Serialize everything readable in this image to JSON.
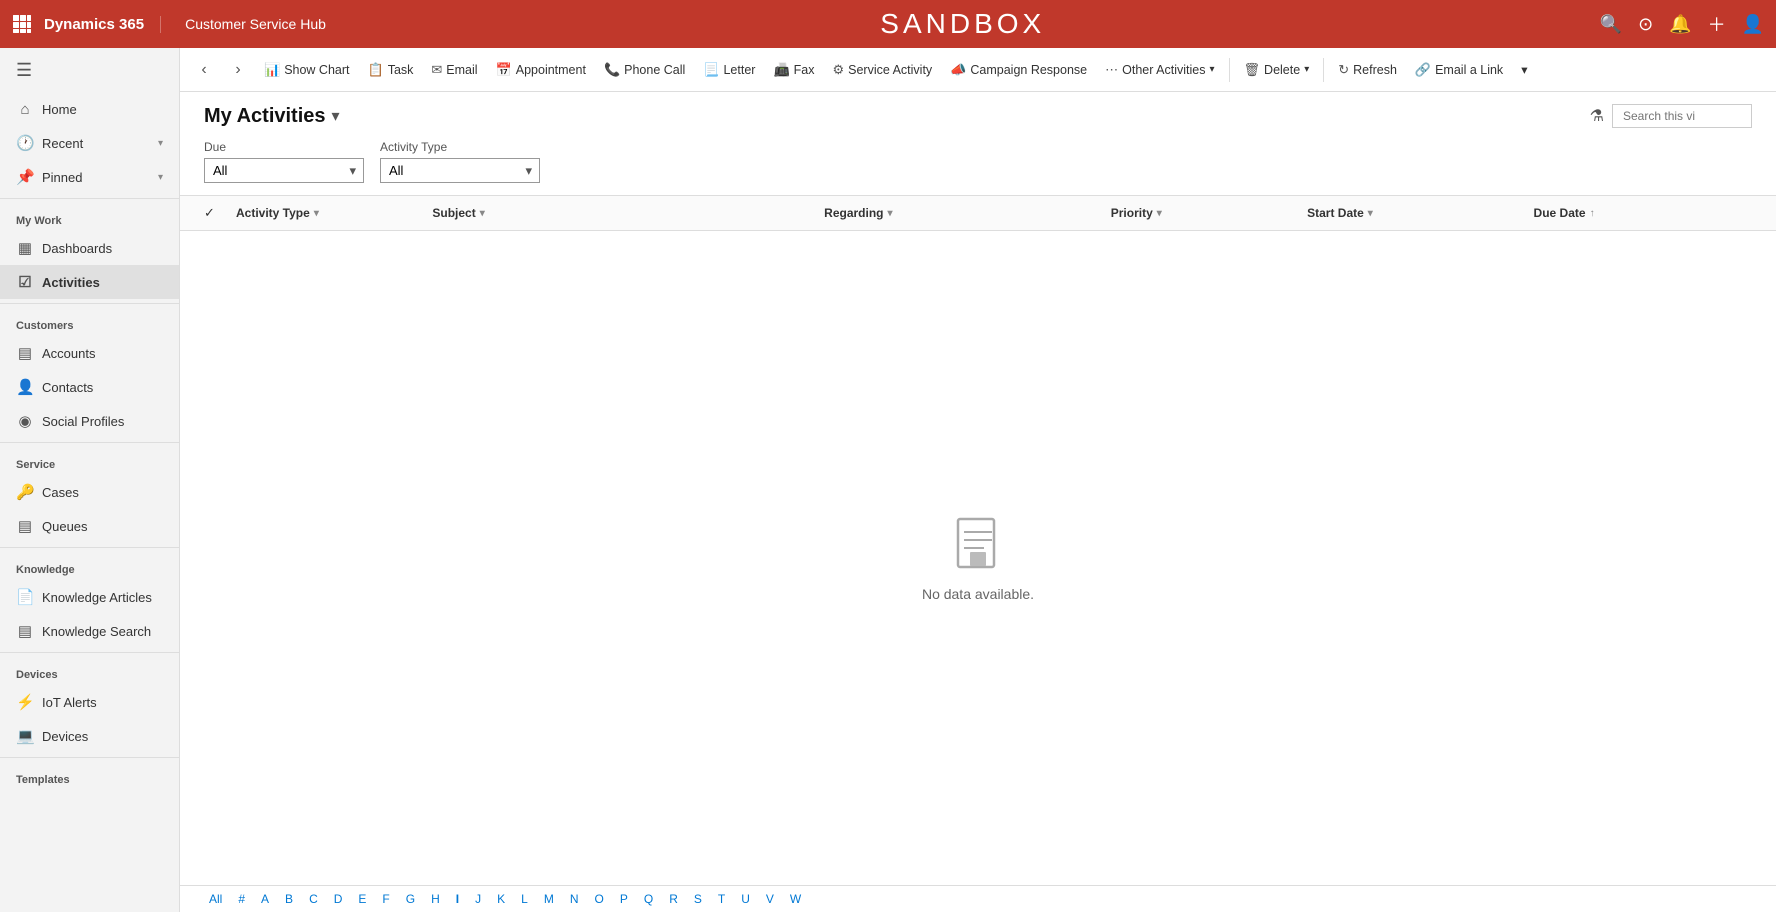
{
  "topNav": {
    "appName": "Dynamics 365",
    "hubName": "Customer Service Hub",
    "sandboxTitle": "SANDBOX"
  },
  "commandBar": {
    "backLabel": "‹",
    "forwardLabel": "›",
    "showChartLabel": "Show Chart",
    "taskLabel": "Task",
    "emailLabel": "Email",
    "appointmentLabel": "Appointment",
    "phoneCallLabel": "Phone Call",
    "letterLabel": "Letter",
    "faxLabel": "Fax",
    "serviceActivityLabel": "Service Activity",
    "campaignResponseLabel": "Campaign Response",
    "otherActivitiesLabel": "Other Activities",
    "deleteLabel": "Delete",
    "refreshLabel": "Refresh",
    "emailLinkLabel": "Email a Link"
  },
  "pageHeader": {
    "title": "My Activities",
    "searchPlaceholder": "Search this vi"
  },
  "filters": {
    "dueLabel": "Due",
    "dueValue": "All",
    "activityTypeLabel": "Activity Type",
    "activityTypeValue": "All"
  },
  "tableColumns": {
    "activityType": "Activity Type",
    "subject": "Subject",
    "regarding": "Regarding",
    "priority": "Priority",
    "startDate": "Start Date",
    "dueDate": "Due Date"
  },
  "emptyState": {
    "message": "No data available."
  },
  "sidebar": {
    "myWorkLabel": "My Work",
    "dashboardsLabel": "Dashboards",
    "activitiesLabel": "Activities",
    "customersLabel": "Customers",
    "accountsLabel": "Accounts",
    "contactsLabel": "Contacts",
    "socialProfilesLabel": "Social Profiles",
    "serviceLabel": "Service",
    "casesLabel": "Cases",
    "queuesLabel": "Queues",
    "knowledgeLabel": "Knowledge",
    "knowledgeArticlesLabel": "Knowledge Articles",
    "knowledgeSearchLabel": "Knowledge Search",
    "devicesLabel": "Devices",
    "iotAlertsLabel": "IoT Alerts",
    "devicesItemLabel": "Devices",
    "templatesLabel": "Templates",
    "homeLabel": "Home",
    "recentLabel": "Recent",
    "pinnedLabel": "Pinned"
  },
  "pagination": {
    "letters": [
      "All",
      "#",
      "A",
      "B",
      "C",
      "D",
      "E",
      "F",
      "G",
      "H",
      "I",
      "J",
      "K",
      "L",
      "M",
      "N",
      "O",
      "P",
      "Q",
      "R",
      "S",
      "T",
      "U",
      "V",
      "W"
    ]
  }
}
